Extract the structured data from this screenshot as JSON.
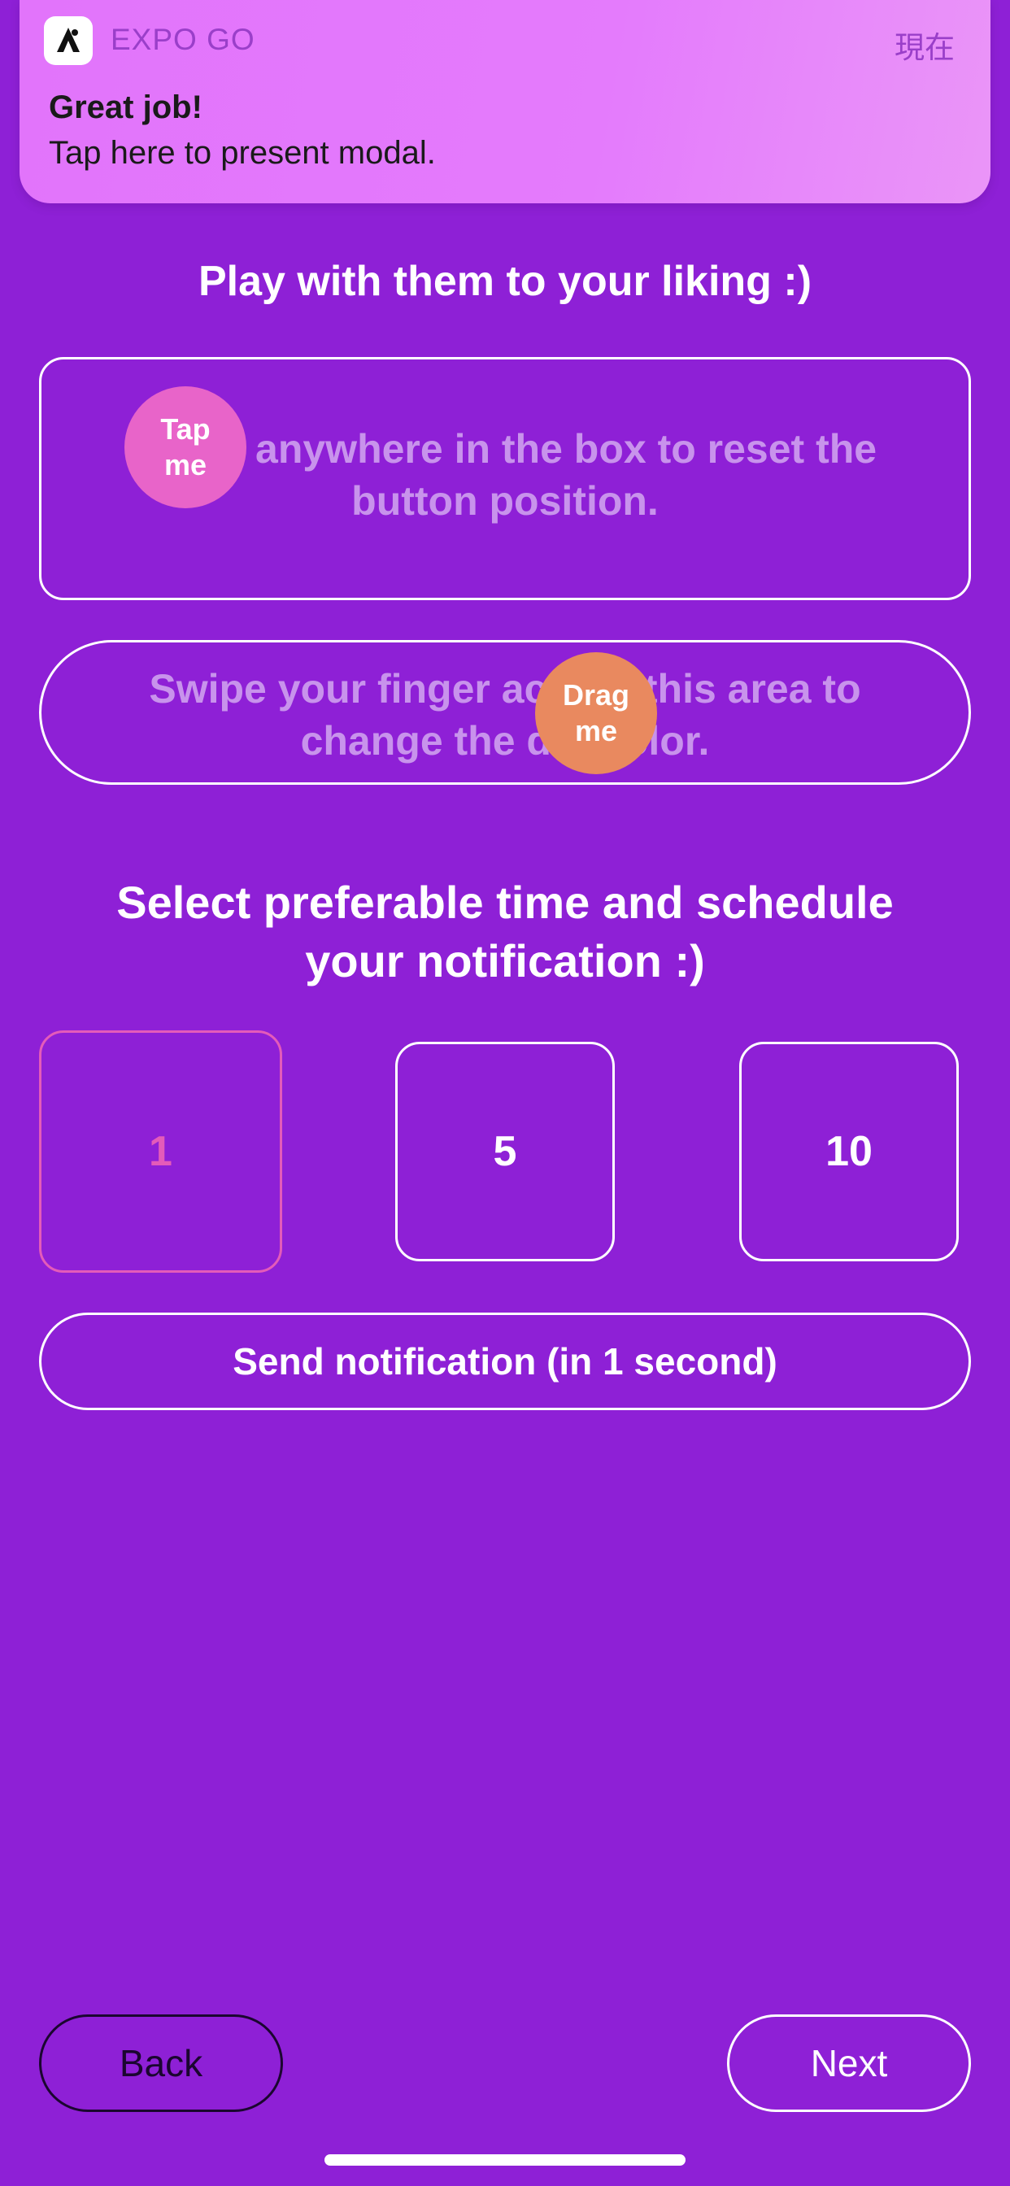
{
  "notification": {
    "app_name": "EXPO GO",
    "time": "現在",
    "title": "Great job!",
    "body": "Tap here to present modal."
  },
  "playground": {
    "heading": "Play with them to your liking :)",
    "press_area_text": "Press anywhere in the box to reset the button position.",
    "tap_button_label": "Tap me",
    "swipe_area_text": "Swipe your finger across this area to change the dot color.",
    "drag_button_label": "Drag me"
  },
  "schedule": {
    "heading": "Select preferable time and schedule your notification :)",
    "options": [
      "1",
      "5",
      "10"
    ],
    "selected_option": "1",
    "send_button_label": "Send notification (in 1 second)"
  },
  "navigation": {
    "back_label": "Back",
    "next_label": "Next"
  },
  "colors": {
    "background": "#8e20d6",
    "banner": "#e47bfc",
    "tap_dot": "#e864c9",
    "drag_dot": "#e9895f",
    "selected_accent": "#e45bb9"
  }
}
